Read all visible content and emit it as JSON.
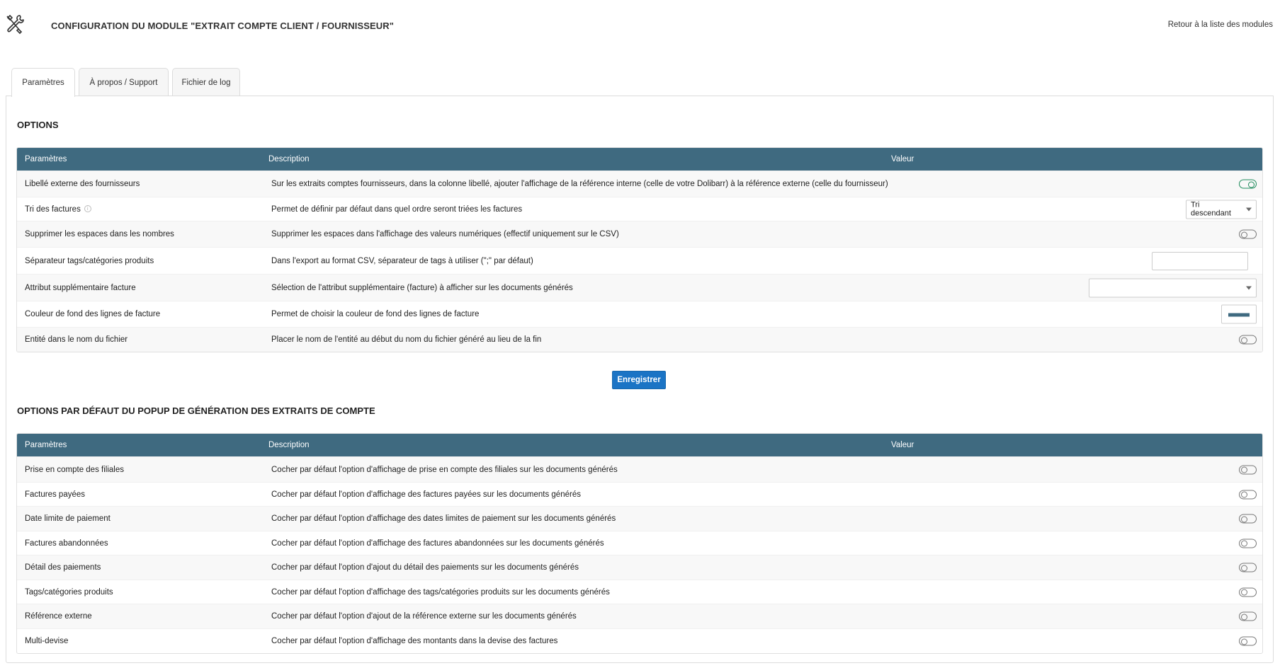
{
  "header": {
    "title": "CONFIGURATION DU MODULE \"EXTRAIT COMPTE CLIENT / FOURNISSEUR\"",
    "back_link": "Retour à la liste des modules",
    "icon": "tools-icon"
  },
  "tabs": [
    {
      "label": "Paramètres",
      "active": true
    },
    {
      "label": "À propos / Support",
      "active": false
    },
    {
      "label": "Fichier de log",
      "active": false
    }
  ],
  "options": {
    "title": "OPTIONS",
    "columns": [
      "Paramètres",
      "Description",
      "Valeur"
    ],
    "rows": [
      {
        "param": "Libellé externe des fournisseurs",
        "desc": "Sur les extraits comptes fournisseurs, dans la colonne libellé, ajouter l'affichage de la référence interne (celle de votre Dolibarr) à la référence externe (celle du fournisseur)",
        "control": "toggle",
        "value": true
      },
      {
        "param": "Tri des factures",
        "desc": "Permet de définir par défaut dans quel ordre seront triées les factures",
        "control": "select",
        "value": "Tri descendant"
      },
      {
        "param": "Supprimer les espaces dans les nombres",
        "desc": "Supprimer les espaces dans l'affichage des valeurs numériques (effectif uniquement sur le CSV)",
        "control": "toggle",
        "value": false
      },
      {
        "param": "Séparateur tags/catégories produits",
        "desc": "Dans l'export au format CSV, séparateur de tags à utiliser (\";\" par défaut)",
        "control": "text",
        "value": ""
      },
      {
        "param": "Attribut supplémentaire facture",
        "desc": "Sélection de l'attribut supplémentaire (facture) à afficher sur les documents générés",
        "control": "select",
        "value": ""
      },
      {
        "param": "Couleur de fond des lignes de facture",
        "desc": "Permet de choisir la couleur de fond des lignes de facture",
        "control": "color",
        "value": "#3f6a80"
      },
      {
        "param": "Entité dans le nom du fichier",
        "desc": "Placer le nom de l'entité au début du nom du fichier généré au lieu de la fin",
        "control": "toggle",
        "value": false
      }
    ],
    "save_label": "Enregistrer"
  },
  "popup_options": {
    "title": "OPTIONS PAR DÉFAUT DU POPUP DE GÉNÉRATION DES EXTRAITS DE COMPTE",
    "columns": [
      "Paramètres",
      "Description",
      "Valeur"
    ],
    "rows": [
      {
        "param": "Prise en compte des filiales",
        "desc": "Cocher par défaut l'option d'affichage de prise en compte des filiales sur les documents générés",
        "value": false
      },
      {
        "param": "Factures payées",
        "desc": "Cocher par défaut l'option d'affichage des factures payées sur les documents générés",
        "value": false
      },
      {
        "param": "Date limite de paiement",
        "desc": "Cocher par défaut l'option d'affichage des dates limites de paiement sur les documents générés",
        "value": false
      },
      {
        "param": "Factures abandonnées",
        "desc": "Cocher par défaut l'option d'affichage des factures abandonnées sur les documents générés",
        "value": false
      },
      {
        "param": "Détail des paiements",
        "desc": "Cocher par défaut l'option d'ajout du détail des paiements sur les documents générés",
        "value": false
      },
      {
        "param": "Tags/catégories produits",
        "desc": "Cocher par défaut l'option d'affichage des tags/catégories produits sur les documents générés",
        "value": false
      },
      {
        "param": "Référence externe",
        "desc": "Cocher par défaut l'option d'ajout de la référence externe sur les documents générés",
        "value": false
      },
      {
        "param": "Multi-devise",
        "desc": "Cocher par défaut l'option d'affichage des montants dans la devise des factures",
        "value": false
      }
    ]
  },
  "colors": {
    "header_bg": "#3f6a80",
    "toggle_on": "#1e8a5b",
    "button": "#1b74c5"
  }
}
